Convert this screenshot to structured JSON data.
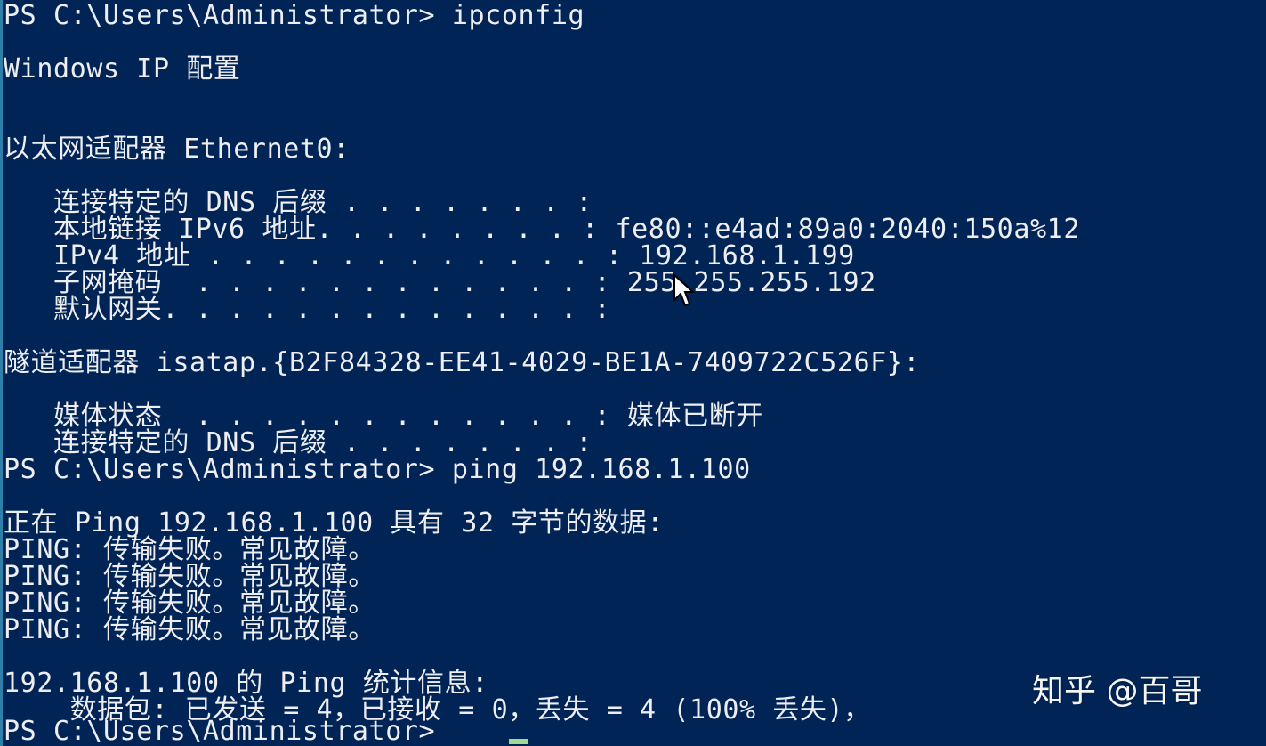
{
  "terminal": {
    "background": "#012456",
    "foreground": "#eeedf0",
    "lines": [
      "PS C:\\Users\\Administrator> ipconfig",
      "",
      "Windows IP 配置",
      "",
      "",
      "以太网适配器 Ethernet0:",
      "",
      "   连接特定的 DNS 后缀 . . . . . . . :",
      "   本地链接 IPv6 地址. . . . . . . . : fe80::e4ad:89a0:2040:150a%12",
      "   IPv4 地址 . . . . . . . . . . . . : 192.168.1.199",
      "   子网掩码  . . . . . . . . . . . . : 255.255.255.192",
      "   默认网关. . . . . . . . . . . . . :",
      "",
      "隧道适配器 isatap.{B2F84328-EE41-4029-BE1A-7409722C526F}:",
      "",
      "   媒体状态  . . . . . . . . . . . . : 媒体已断开",
      "   连接特定的 DNS 后缀 . . . . . . . :",
      "PS C:\\Users\\Administrator> ping 192.168.1.100",
      "",
      "正在 Ping 192.168.1.100 具有 32 字节的数据:",
      "PING: 传输失败。常见故障。",
      "PING: 传输失败。常见故障。",
      "PING: 传输失败。常见故障。",
      "PING: 传输失败。常见故障。",
      "",
      "192.168.1.100 的 Ping 统计信息:",
      "    数据包: 已发送 = 4，已接收 = 0，丢失 = 4 (100% 丢失)，",
      "PS C:\\Users\\Administrator> "
    ]
  },
  "cursor_color": "#9fdb8f",
  "mouse_pointer_icon": "arrow-cursor-icon",
  "watermark": "知乎 @百哥"
}
